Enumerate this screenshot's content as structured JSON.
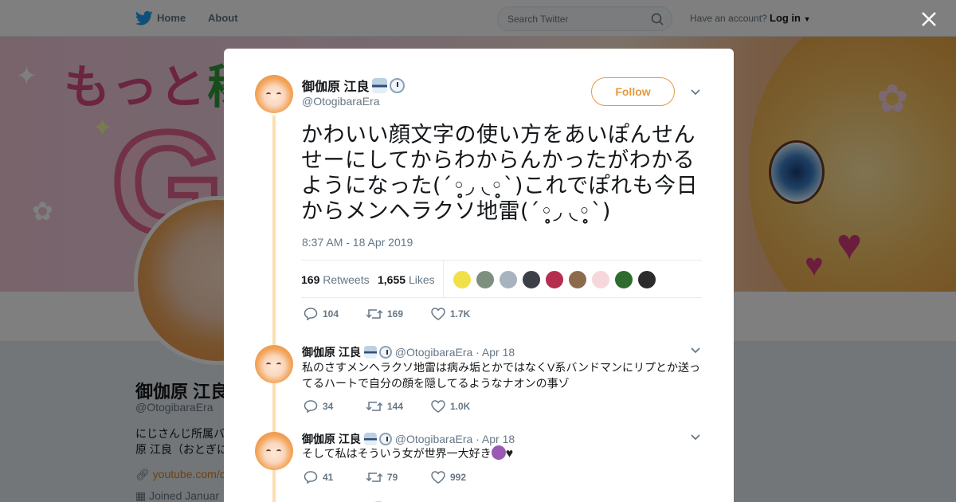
{
  "nav": {
    "home_label": "Home",
    "about_label": "About",
    "search_placeholder": "Search Twitter",
    "account_text": "Have an account?",
    "login_label": "Log in"
  },
  "profile": {
    "name": "御伽原 江良",
    "handle": "@OtogibaraEra",
    "bio_line1": "にじさんじ所属バ",
    "bio_line2": "原 江良（おとぎに",
    "link": "youtube.com/c",
    "joined": "Joined Januar"
  },
  "banner": {
    "text_pink_1": "もっと",
    "text_green": "稼",
    "big_letter": "G"
  },
  "tweet": {
    "author_name": "御伽原 江良",
    "author_handle": "@OtogibaraEra",
    "follow_label": "Follow",
    "text": "かわいい顔文字の使い方をあいぽんせんせーにしてからわからんかったがわかるようになった(´◦̥̥̥◞ ◟◦̥̥̥`)これでぽれも今日からメンヘラクソ地雷(´◦̥̥̥◞ ◟◦̥̥̥`)",
    "timestamp": "8:37 AM - 18 Apr 2019",
    "retweets_count": "169",
    "retweets_label": "Retweets",
    "likes_count": "1,655",
    "likes_label": "Likes",
    "replies_action": "104",
    "retweets_action": "169",
    "likes_action": "1.7K",
    "liker_colors": [
      "#f1e04a",
      "#7e8f7f",
      "#a7b3bf",
      "#3c4046",
      "#b62e4f",
      "#8c6b4c",
      "#f5d7dc",
      "#2f6b2c",
      "#2b2b2b"
    ]
  },
  "replies": [
    {
      "name": "御伽原 江良",
      "handle": "@OtogibaraEra",
      "date": "· Apr 18",
      "text": "私のさすメンヘラクソ地雷は病み垢とかではなくV系バンドマンにリプとか送ってるハートで自分の顔を隠してるようなナオンの事ゾ",
      "replies": "34",
      "retweets": "144",
      "likes": "1.0K"
    },
    {
      "name": "御伽原 江良",
      "handle": "@OtogibaraEra",
      "date": "· Apr 18",
      "text": "そして私はそういう女が世界一大好き",
      "replies": "41",
      "retweets": "79",
      "likes": "992"
    }
  ],
  "colors": {
    "accent": "#e49a42",
    "thread_line": "#fddfb0",
    "twitter_blue": "#1da1f2"
  }
}
